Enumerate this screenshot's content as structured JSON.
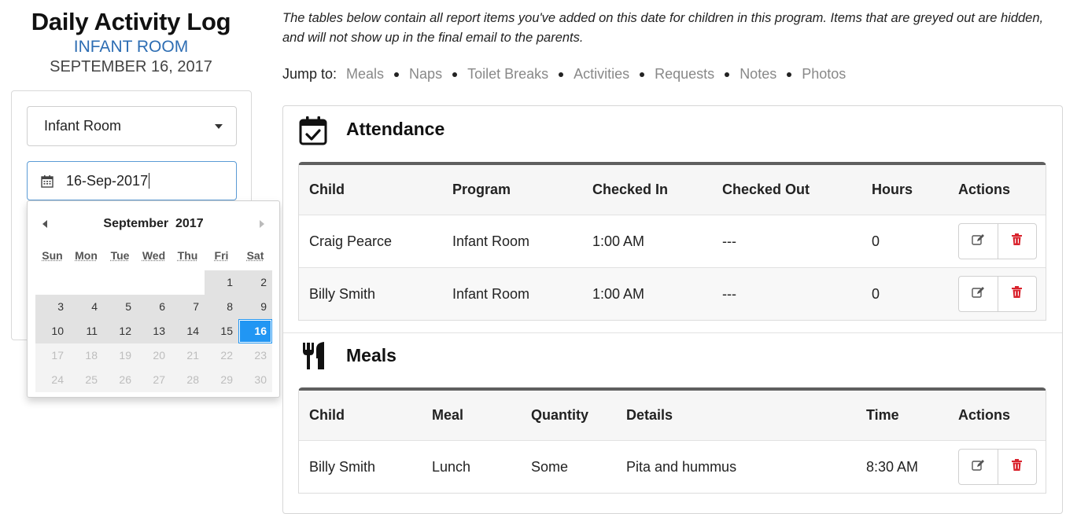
{
  "header": {
    "title": "Daily Activity Log",
    "room": "INFANT ROOM",
    "date": "SEPTEMBER 16, 2017"
  },
  "filters": {
    "program_select": "Infant Room",
    "date_value": "16-Sep-2017"
  },
  "datepicker": {
    "month": "September",
    "year": "2017",
    "weekdays": [
      "Sun",
      "Mon",
      "Tue",
      "Wed",
      "Thu",
      "Fri",
      "Sat"
    ],
    "rows": [
      [
        "",
        "",
        "",
        "",
        "",
        "1",
        "2"
      ],
      [
        "3",
        "4",
        "5",
        "6",
        "7",
        "8",
        "9"
      ],
      [
        "10",
        "11",
        "12",
        "13",
        "14",
        "15",
        "16"
      ],
      [
        "17",
        "18",
        "19",
        "20",
        "21",
        "22",
        "23"
      ],
      [
        "24",
        "25",
        "26",
        "27",
        "28",
        "29",
        "30"
      ]
    ],
    "selected": "16",
    "selected_color": "#2196f3"
  },
  "intro": "The tables below contain all report items you've added on this date for children in this program. Items that are greyed out are hidden, and will not show up in the final email to the parents.",
  "jump": {
    "label": "Jump to:",
    "links": [
      "Meals",
      "Naps",
      "Toilet Breaks",
      "Activities",
      "Requests",
      "Notes",
      "Photos"
    ]
  },
  "attendance": {
    "title": "Attendance",
    "icon": "calendar-check-icon",
    "columns": [
      "Child",
      "Program",
      "Checked In",
      "Checked Out",
      "Hours",
      "Actions"
    ],
    "rows": [
      [
        "Craig Pearce",
        "Infant Room",
        "1:00 AM",
        "---",
        "0"
      ],
      [
        "Billy Smith",
        "Infant Room",
        "1:00 AM",
        "---",
        "0"
      ]
    ]
  },
  "meals": {
    "title": "Meals",
    "icon": "utensils-icon",
    "columns": [
      "Child",
      "Meal",
      "Quantity",
      "Details",
      "Time",
      "Actions"
    ],
    "rows": [
      [
        "Billy Smith",
        "Lunch",
        "Some",
        "Pita and hummus",
        "8:30 AM"
      ]
    ]
  },
  "colors": {
    "accent": "#2d6db3",
    "delete": "#d9232d",
    "link_muted": "#888888"
  }
}
